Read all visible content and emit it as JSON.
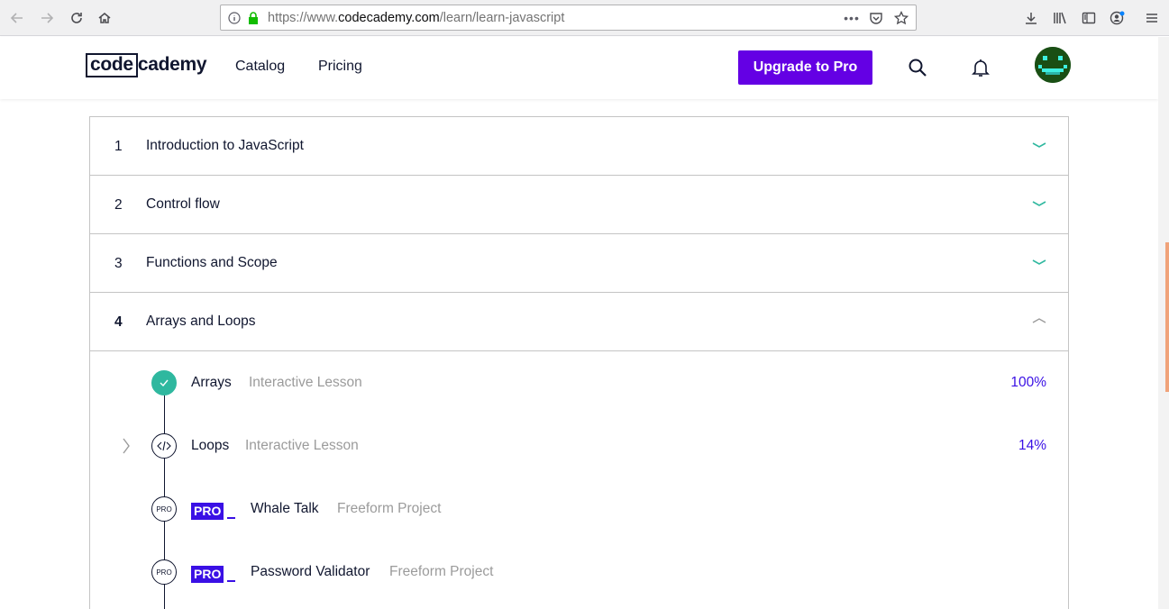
{
  "browser": {
    "url_prefix": "https://www.",
    "url_domain": "codecademy.com",
    "url_path": "/learn/learn-javascript"
  },
  "header": {
    "logo_boxed": "code",
    "logo_rest": "cademy",
    "nav": [
      "Catalog",
      "Pricing"
    ],
    "upgrade_label": "Upgrade to Pro"
  },
  "modules": [
    {
      "num": "1",
      "title": "Introduction to JavaScript",
      "expanded": false
    },
    {
      "num": "2",
      "title": "Control flow",
      "expanded": false
    },
    {
      "num": "3",
      "title": "Functions and Scope",
      "expanded": false
    },
    {
      "num": "4",
      "title": "Arrays and Loops",
      "expanded": true
    }
  ],
  "lessons": [
    {
      "title": "Arrays",
      "type": "Interactive Lesson",
      "progress": "100%",
      "status": "complete"
    },
    {
      "title": "Loops",
      "type": "Interactive Lesson",
      "progress": "14%",
      "status": "in-progress"
    },
    {
      "title": "Whale Talk",
      "type": "Freeform Project",
      "badge": "PRO",
      "circle_label": "PRO"
    },
    {
      "title": "Password Validator",
      "type": "Freeform Project",
      "badge": "PRO",
      "circle_label": "PRO"
    }
  ],
  "colors": {
    "brand_purple": "#6400e4",
    "pro_blue": "#3a10e5",
    "teal": "#2fb89f",
    "navy": "#10162f"
  }
}
